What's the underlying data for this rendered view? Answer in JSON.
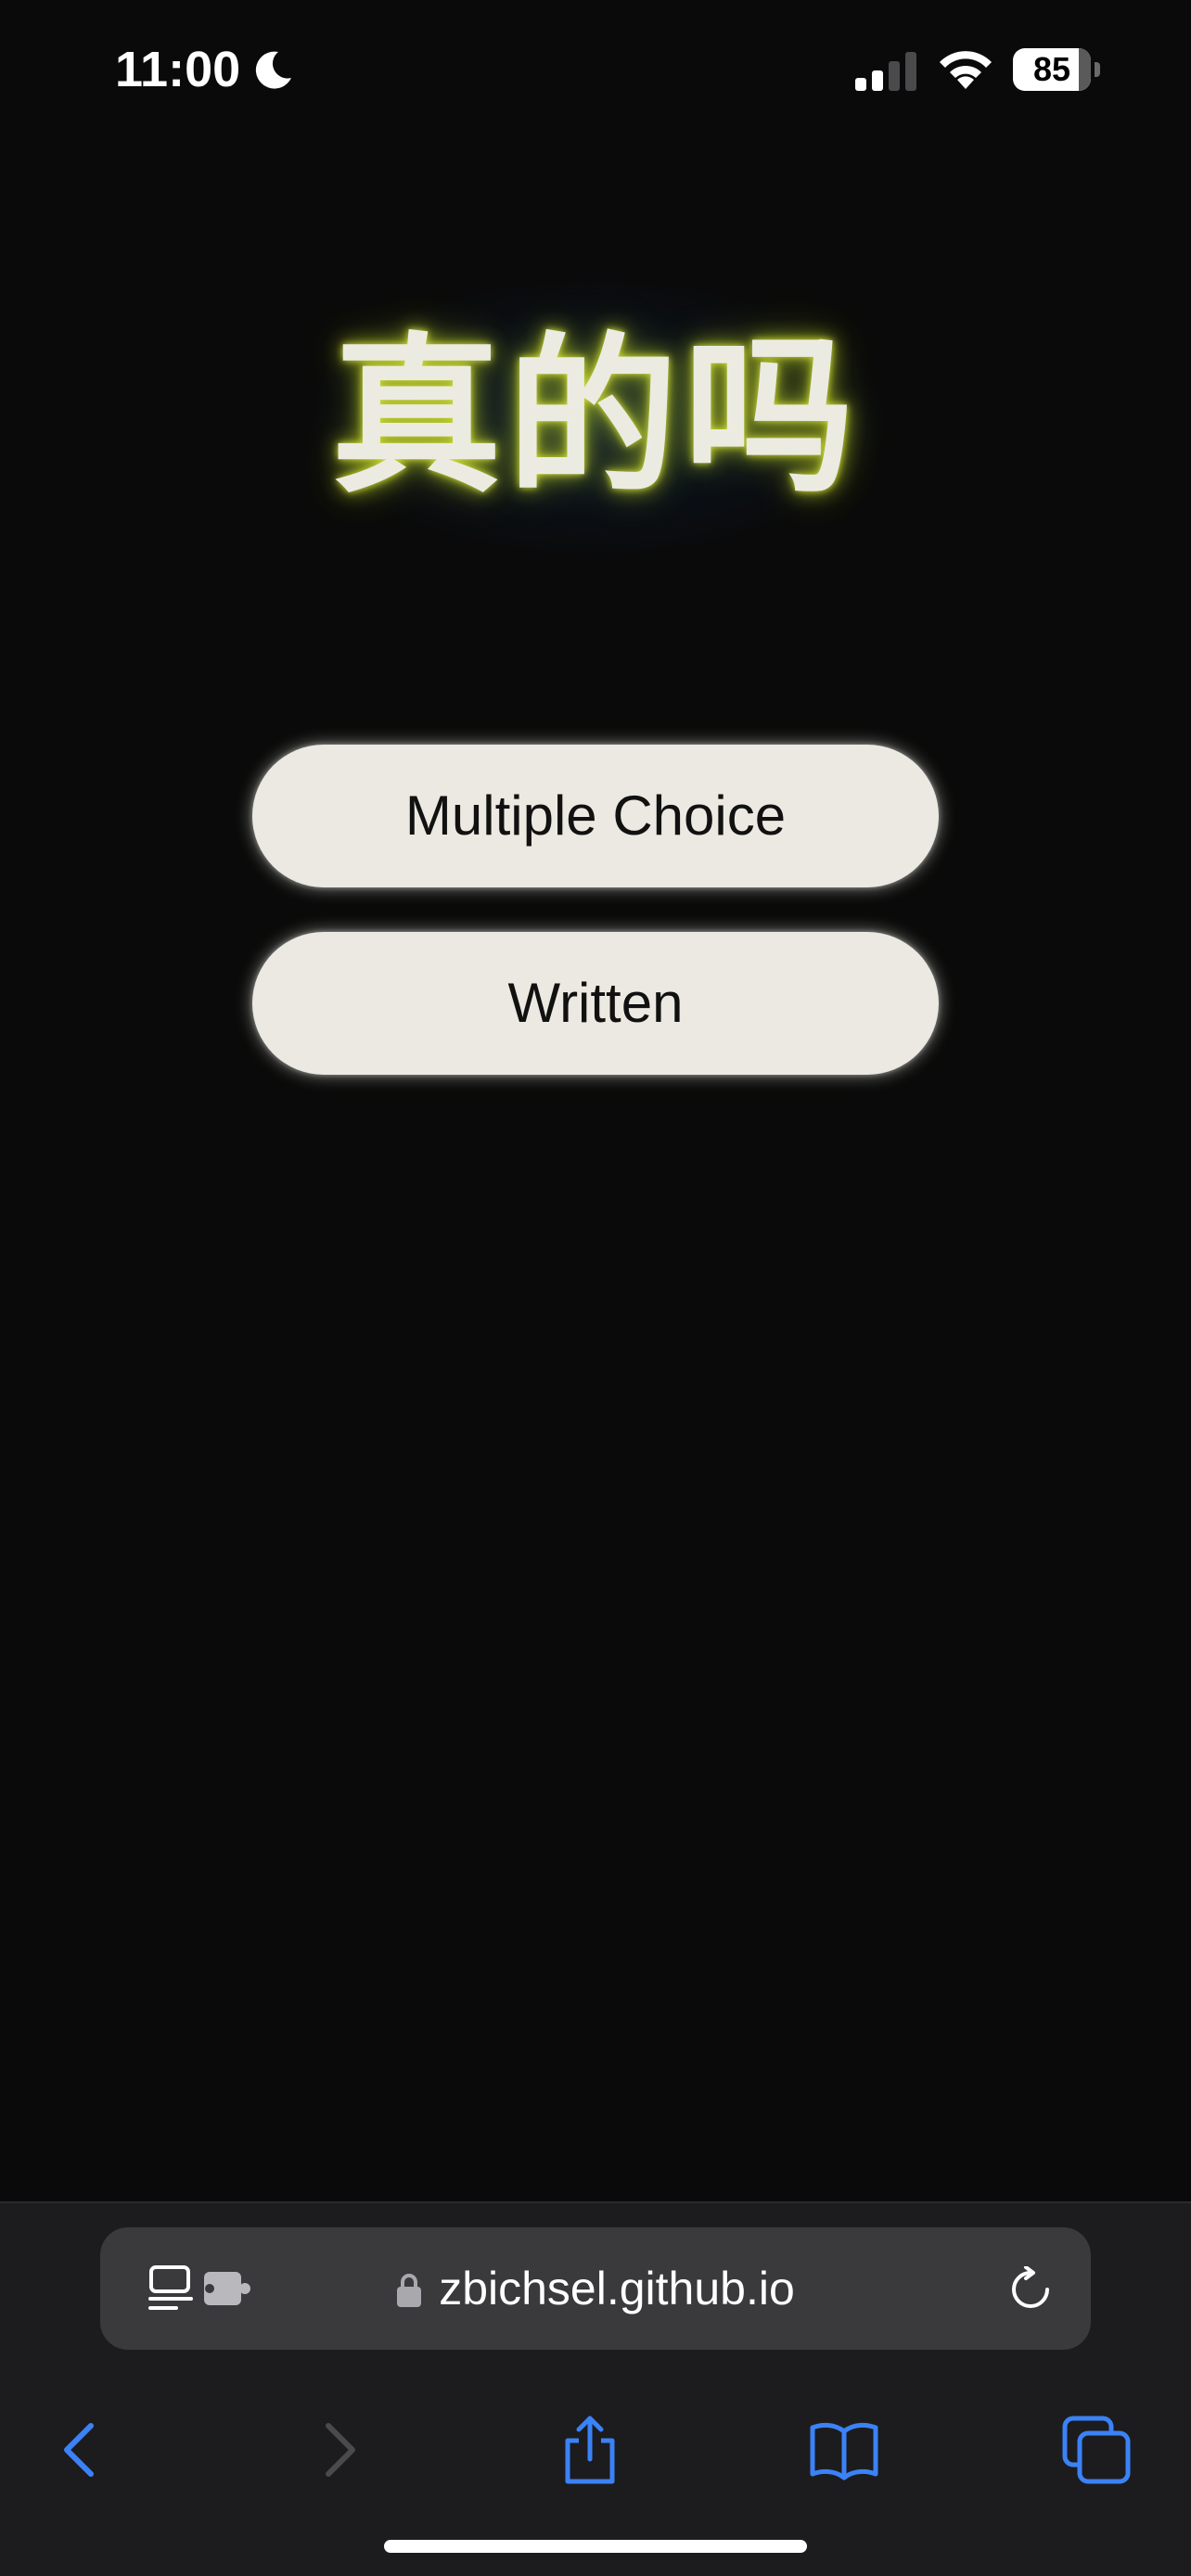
{
  "status_bar": {
    "time": "11:00",
    "battery_level": 85,
    "battery_text": "85",
    "signal_bars_active": 2,
    "signal_bars_total": 4,
    "icons": [
      "moon-icon",
      "signal-icon",
      "wifi-icon",
      "battery-icon"
    ]
  },
  "app": {
    "title": "真的吗",
    "buttons": {
      "multiple_choice": "Multiple Choice",
      "written": "Written"
    }
  },
  "browser": {
    "url": "zbichsel.github.io",
    "address_icons": [
      "reader-icon",
      "extension-icon",
      "lock-icon",
      "reload-icon"
    ],
    "toolbar_icons": [
      "back-icon",
      "forward-icon",
      "share-icon",
      "bookmarks-icon",
      "tabs-icon"
    ]
  },
  "colors": {
    "background": "#0a0a0a",
    "title_text": "#ecebe2",
    "title_glow": "#d6e43c",
    "button_bg": "#ebe9e1",
    "button_text": "#111111",
    "browser_chrome": "#1c1c1e",
    "address_bar": "#3a3a3c",
    "accent_blue": "#3b82f6",
    "disabled_gray": "#4a4a4c"
  }
}
